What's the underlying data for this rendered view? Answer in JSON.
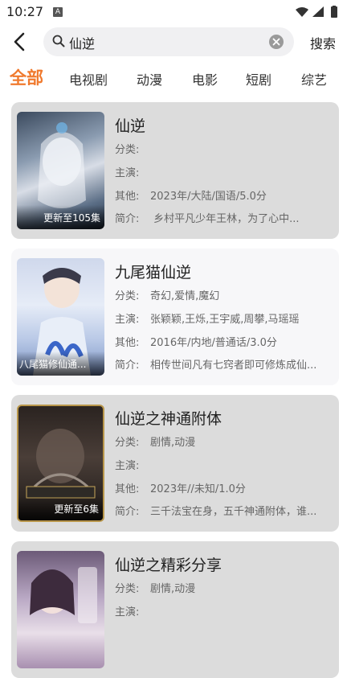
{
  "status": {
    "time": "10:27",
    "notif": "A"
  },
  "search": {
    "query": "仙逆",
    "submit_label": "搜索"
  },
  "tabs": [
    "全部",
    "电视剧",
    "动漫",
    "电影",
    "短剧",
    "综艺"
  ],
  "labels": {
    "genre": "分类:",
    "cast": "主演:",
    "other": "其他:",
    "intro": "简介:"
  },
  "results": [
    {
      "title": "仙逆",
      "badge": "更新至105集",
      "genre": "",
      "cast": "",
      "other": "2023年/大陆/国语/5.0分",
      "intro": "     乡村平凡少年王林，为了心中..."
    },
    {
      "title": "九尾猫仙逆",
      "badge": "八尾猫修仙通...",
      "genre": "奇幻,爱情,魔幻",
      "cast": "张颖颖,王烁,王宇威,周攀,马瑶瑶",
      "other": "2016年/内地/普通话/3.0分",
      "intro": "相传世间凡有七窍者即可修炼成仙..."
    },
    {
      "title": "仙逆之神通附体",
      "badge": "更新至6集",
      "genre": "剧情,动漫",
      "cast": "",
      "other": "2023年//未知/1.0分",
      "intro": "三千法宝在身，五千神通附体，谁..."
    },
    {
      "title": "仙逆之精彩分享",
      "badge": "",
      "genre": "剧情,动漫",
      "cast": "",
      "other": "",
      "intro": ""
    }
  ]
}
